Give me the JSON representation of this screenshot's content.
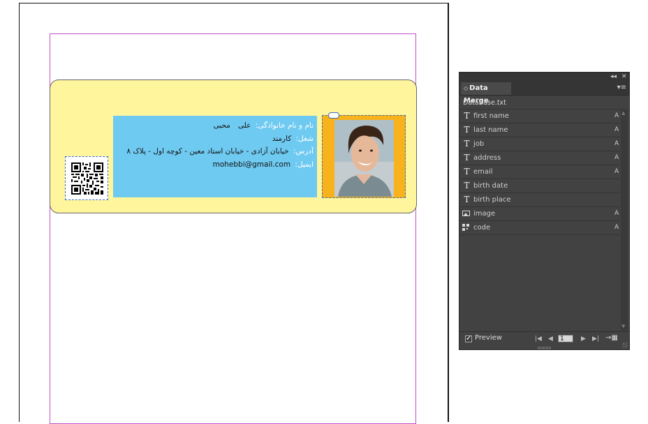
{
  "card": {
    "name_label": "نام و نام خانوادگی:",
    "first_name": "علی",
    "last_name": "محبی",
    "job_label": "شغل:",
    "job": "کارمند",
    "address_label": "آدرس:",
    "address": "خیابان آزادی - خیابان استاد معین - کوچه اول - پلاک ۸",
    "email_label": "ایمیل:",
    "email": "mohebbi@gmail.com"
  },
  "colors": {
    "card_bg": "#fff59d",
    "info_bg": "#6fcaf1",
    "photo_bg": "#f7b21c",
    "frame_border": "#3d6fb0",
    "margin_guide": "#c050c8",
    "panel_bg": "#424242"
  },
  "panel": {
    "title": "Data Merge",
    "collapse_glyph": "◂◂",
    "close_glyph": "✕",
    "tab_glyph": "◇",
    "menu_glyph": "▾≡",
    "source_file": "DataBase.txt",
    "fields": [
      {
        "name": "first name",
        "icon": "text-field-icon",
        "glyph": "T",
        "mark": "A"
      },
      {
        "name": "last name",
        "icon": "text-field-icon",
        "glyph": "T",
        "mark": "A"
      },
      {
        "name": "job",
        "icon": "text-field-icon",
        "glyph": "T",
        "mark": "A"
      },
      {
        "name": "address",
        "icon": "text-field-icon",
        "glyph": "T",
        "mark": "A"
      },
      {
        "name": "email",
        "icon": "text-field-icon",
        "glyph": "T",
        "mark": "A"
      },
      {
        "name": "birth date",
        "icon": "text-field-icon",
        "glyph": "T",
        "mark": ""
      },
      {
        "name": "birth place",
        "icon": "text-field-icon",
        "glyph": "T",
        "mark": ""
      },
      {
        "name": "image",
        "icon": "image-field-icon",
        "glyph": "",
        "mark": "A"
      },
      {
        "name": "code",
        "icon": "qr-field-icon",
        "glyph": "",
        "mark": "A"
      }
    ],
    "scroll_up_glyph": "▲",
    "scroll_down_glyph": "▼",
    "preview_label": "Preview",
    "preview_checked_glyph": "✓",
    "record_number": "1",
    "nav": {
      "first": "|◀",
      "prev": "◀",
      "next": "▶",
      "last": "▶|",
      "create": "→▦"
    }
  }
}
